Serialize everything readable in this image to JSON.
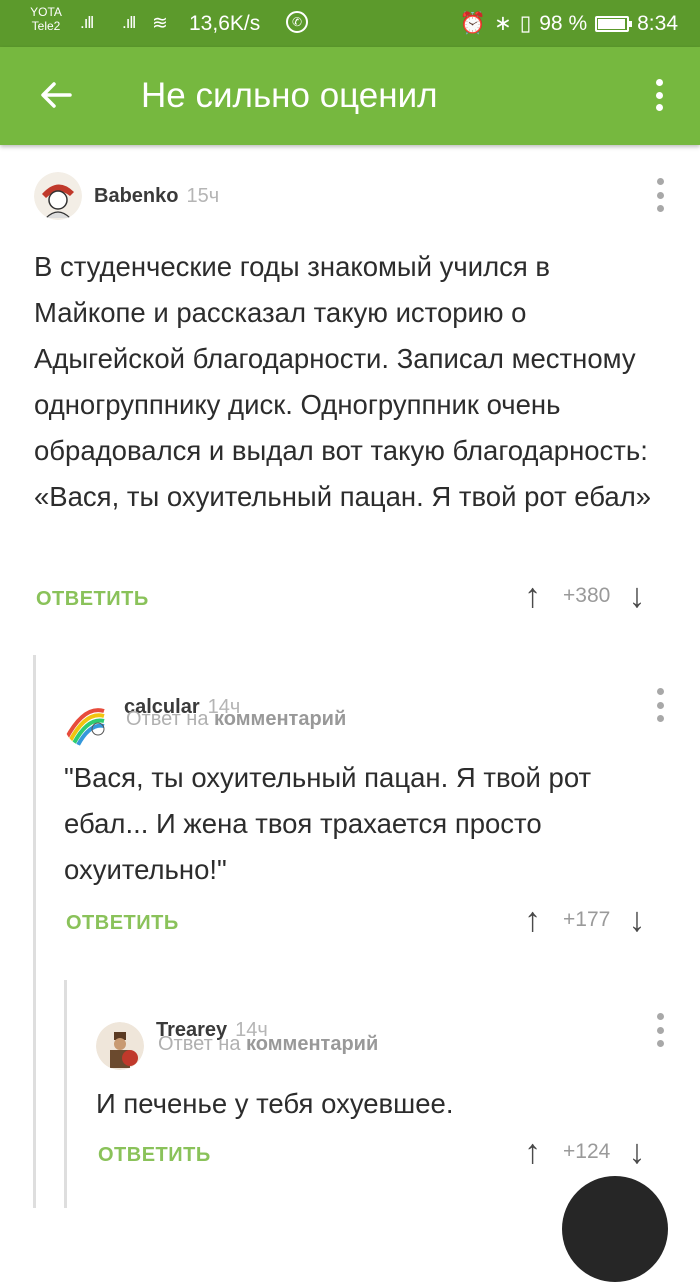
{
  "status_bar": {
    "carrier_top": "YOTA",
    "carrier_bottom": "Tele2",
    "speed": "13,6K/s",
    "battery": "98 %",
    "battery_level": 0.98,
    "time": "8:34"
  },
  "app_bar": {
    "title": "Не сильно оценил",
    "back_icon": "arrow-left-icon",
    "menu_icon": "more-vertical-icon"
  },
  "comments": [
    {
      "author": "Babenko",
      "time": "15ч",
      "reply_to_prefix": "",
      "reply_to_link": "",
      "text": "В студенческие годы знакомый учился в Майкопе и рассказал такую историю о Адыгейской благодарности. Записал местному одногруппнику диск. Одногруппник очень обрадовался и выдал вот такую благодарность: «Вася, ты охуительный пацан. Я твой рот ебал»",
      "reply_label": "ОТВЕТИТЬ",
      "score": "+380"
    },
    {
      "author": "calcular",
      "time": "14ч",
      "reply_to_prefix": "Ответ на",
      "reply_to_link": "комментарий",
      "text": "\"Вася, ты охуительный пацан. Я твой рот ебал...  И жена твоя трахается просто охуительно!\"",
      "reply_label": "ОТВЕТИТЬ",
      "score": "+177"
    },
    {
      "author": "Trearey",
      "time": "14ч",
      "reply_to_prefix": "Ответ на",
      "reply_to_link": "комментарий",
      "text": "И печенье у тебя охуевшее.",
      "reply_label": "ОТВЕТИТЬ",
      "score": "+124"
    }
  ],
  "colors": {
    "status_bar": "#5c9a2c",
    "app_bar": "#76b83f",
    "reply_button": "#8ac25a"
  }
}
